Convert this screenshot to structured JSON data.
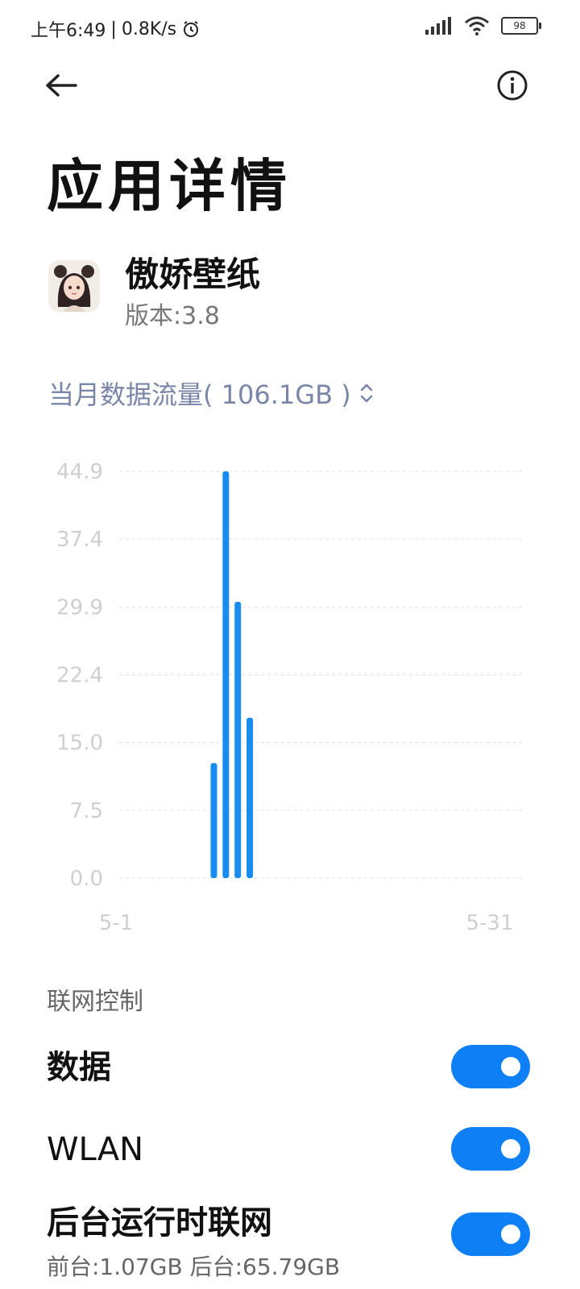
{
  "status_bar": {
    "time": "上午6:49",
    "net_speed": "0.8K/s",
    "battery": "98"
  },
  "header": {
    "title": "应用详情"
  },
  "app": {
    "name": "傲娇壁纸",
    "version": "版本:3.8"
  },
  "traffic": {
    "label": "当月数据流量( 106.1GB )"
  },
  "chart_data": {
    "type": "bar",
    "x_start_label": "5-1",
    "x_end_label": "5-31",
    "y_ticks": [
      "44.9",
      "37.4",
      "29.9",
      "22.4",
      "15.0",
      "7.5",
      "0.0"
    ],
    "ylim": [
      0,
      44.9
    ],
    "bars": [
      {
        "day": 5,
        "value": 12.7
      },
      {
        "day": 6,
        "value": 44.9
      },
      {
        "day": 7,
        "value": 30.5
      },
      {
        "day": 8,
        "value": 17.7
      }
    ],
    "color": "#1a8cf0",
    "grid": true
  },
  "network_control": {
    "section_label": "联网控制",
    "items": [
      {
        "label": "数据",
        "on": true
      },
      {
        "label": "WLAN",
        "on": true
      },
      {
        "label": "后台运行时联网",
        "sub": "前台:1.07GB  后台:65.79GB",
        "on": true
      }
    ]
  }
}
